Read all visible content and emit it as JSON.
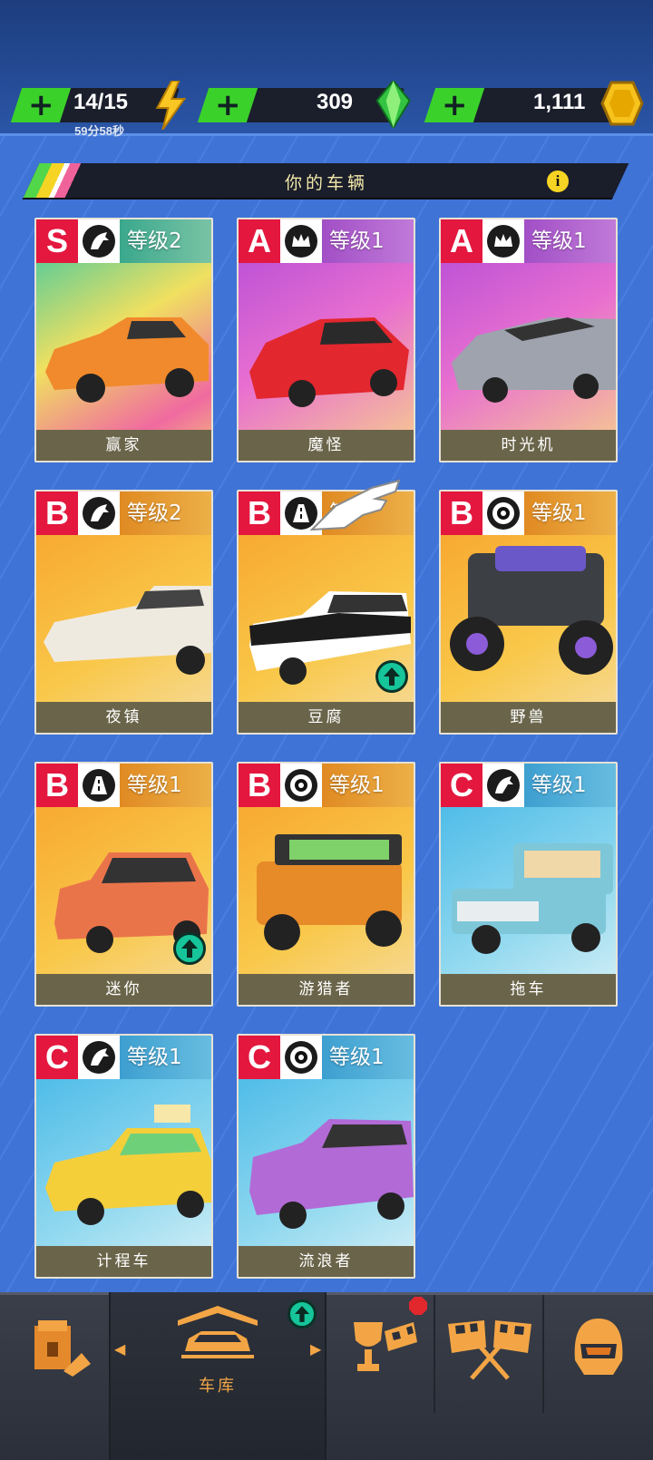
{
  "resources": {
    "energy": {
      "value": "14/15",
      "timer": "59分58秒",
      "icon": "lightning-icon"
    },
    "gems": {
      "value": "309",
      "icon": "green-gem-icon"
    },
    "coins": {
      "value": "1,111",
      "icon": "gold-coin-icon"
    },
    "plus_label": "+"
  },
  "header": {
    "title": "你的车辆",
    "info_label": "i"
  },
  "cars": [
    {
      "rank": "S",
      "level": "等级2",
      "name": "赢家",
      "icon": "horse-icon"
    },
    {
      "rank": "A",
      "level": "等级1",
      "name": "魔怪",
      "icon": "crown-icon"
    },
    {
      "rank": "A",
      "level": "等级1",
      "name": "时光机",
      "icon": "crown-icon"
    },
    {
      "rank": "B",
      "level": "等级2",
      "name": "夜镇",
      "icon": "horse-icon"
    },
    {
      "rank": "B",
      "level": "等",
      "name": "豆腐",
      "icon": "road-icon",
      "upgrade": true
    },
    {
      "rank": "B",
      "level": "等级1",
      "name": "野兽",
      "icon": "tire-icon"
    },
    {
      "rank": "B",
      "level": "等级1",
      "name": "迷你",
      "icon": "road-icon",
      "upgrade": true
    },
    {
      "rank": "B",
      "level": "等级1",
      "name": "游猎者",
      "icon": "tire-icon"
    },
    {
      "rank": "C",
      "level": "等级1",
      "name": "拖车",
      "icon": "horse-icon"
    },
    {
      "rank": "C",
      "level": "等级1",
      "name": "计程车",
      "icon": "horse-icon"
    },
    {
      "rank": "C",
      "level": "等级1",
      "name": "流浪者",
      "icon": "tire-icon"
    }
  ],
  "bottom_nav": {
    "garage_label": "车库",
    "items": [
      "shop-icon",
      "garage-car-icon",
      "trophy-flag-icon",
      "checkered-flags-icon",
      "helmet-icon"
    ]
  },
  "colors": {
    "rank_S": "#e4173f",
    "rank_A": "#e4173f",
    "rank_B": "#e4173f",
    "rank_C": "#e4173f",
    "plus_green": "#3bd12b",
    "accent_orange": "#f3a545",
    "upgrade_teal": "#16c59a"
  }
}
